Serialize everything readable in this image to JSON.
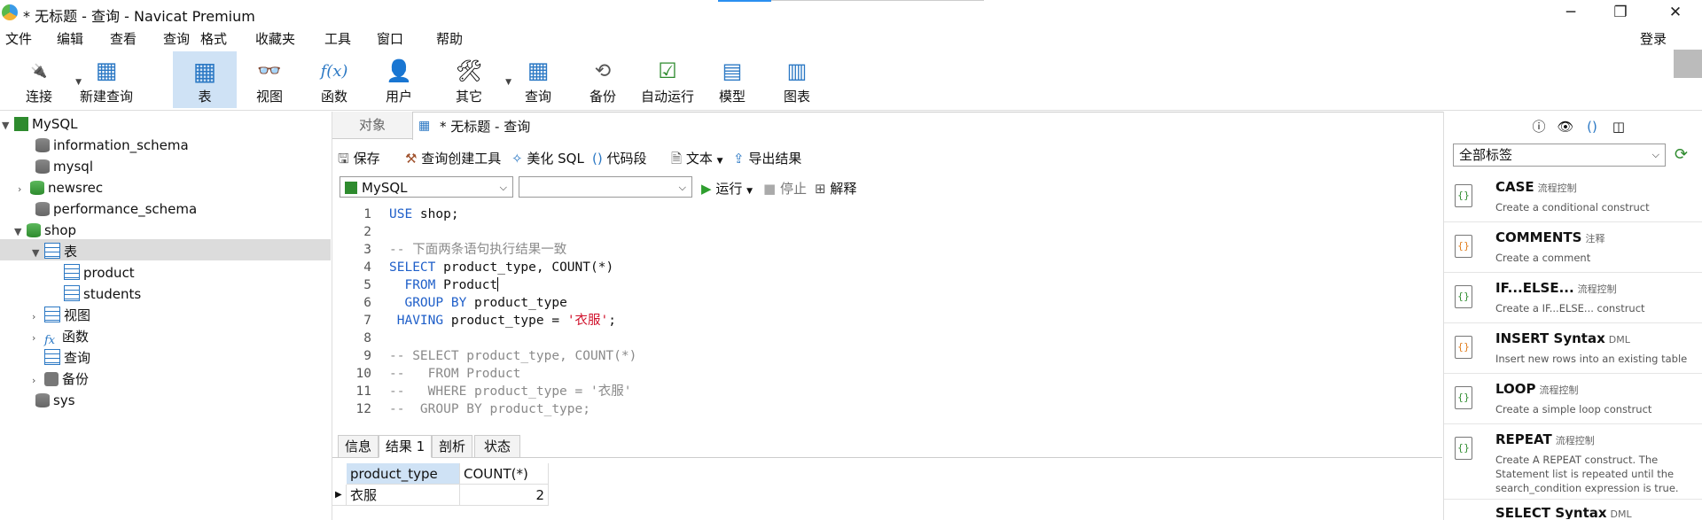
{
  "window": {
    "title": "* 无标题 - 查询 - Navicat Premium",
    "minimize": "─",
    "maximize": "❐",
    "close": "✕"
  },
  "menu": [
    "文件",
    "编辑",
    "查看",
    "查询",
    "格式",
    "收藏夹",
    "工具",
    "窗口",
    "帮助"
  ],
  "login": "登录",
  "toolbar": [
    {
      "label": "连接",
      "icon": "plug-icon",
      "glyph": "🔌"
    },
    {
      "label": "新建查询",
      "icon": "new-query-icon",
      "glyph": "▦"
    },
    {
      "label": "表",
      "icon": "table-icon",
      "glyph": "▦"
    },
    {
      "label": "视图",
      "icon": "view-icon",
      "glyph": "👓"
    },
    {
      "label": "函数",
      "icon": "function-icon",
      "glyph": "f(x)"
    },
    {
      "label": "用户",
      "icon": "user-icon",
      "glyph": "👤"
    },
    {
      "label": "其它",
      "icon": "tools-icon",
      "glyph": "🛠"
    },
    {
      "label": "查询",
      "icon": "query-icon",
      "glyph": "▦"
    },
    {
      "label": "备份",
      "icon": "backup-icon",
      "glyph": "⟲"
    },
    {
      "label": "自动运行",
      "icon": "schedule-icon",
      "glyph": "☑"
    },
    {
      "label": "模型",
      "icon": "model-icon",
      "glyph": "▤"
    },
    {
      "label": "图表",
      "icon": "chart-icon",
      "glyph": "▥"
    }
  ],
  "tree": {
    "connection": "MySQL",
    "databases": [
      "information_schema",
      "mysql",
      "newsrec",
      "performance_schema",
      "shop"
    ],
    "shop_children": {
      "tables": "表",
      "views": "视图",
      "functions": "函数",
      "queries": "查询",
      "backups": "备份"
    },
    "tables": [
      "product",
      "students"
    ],
    "last": "sys"
  },
  "tabs": {
    "objects": "对象",
    "query": "* 无标题 - 查询"
  },
  "query_toolbar": {
    "save": "保存",
    "builder": "查询创建工具",
    "beautify": "美化 SQL",
    "snippet": "代码段",
    "text": "文本",
    "export": "导出结果"
  },
  "db_bar": {
    "connection": "MySQL",
    "database": "",
    "run": "运行",
    "stop": "停止",
    "explain": "解释"
  },
  "editor_lines": [
    "USE shop;",
    "",
    "-- 下面两条语句执行结果一致",
    "SELECT product_type, COUNT(*)",
    "  FROM Product",
    "  GROUP BY product_type",
    " HAVING product_type = '衣服';",
    "",
    "-- SELECT product_type, COUNT(*)",
    "--   FROM Product",
    "--   WHERE product_type = '衣服'",
    "--  GROUP BY product_type;"
  ],
  "result_tabs": [
    "信息",
    "结果 1",
    "剖析",
    "状态"
  ],
  "result": {
    "columns": [
      "product_type",
      "COUNT(*)"
    ],
    "rows": [
      [
        "衣服",
        "2"
      ]
    ]
  },
  "right_panel": {
    "tag_select": "全部标签",
    "snippets": [
      {
        "name": "CASE",
        "cat": "流程控制",
        "desc": "Create a conditional construct"
      },
      {
        "name": "COMMENTS",
        "cat": "注释",
        "desc": "Create a comment"
      },
      {
        "name": "IF...ELSE...",
        "cat": "流程控制",
        "desc": "Create a IF...ELSE... construct"
      },
      {
        "name": "INSERT Syntax",
        "cat": "DML",
        "desc": "Insert new rows into an existing table"
      },
      {
        "name": "LOOP",
        "cat": "流程控制",
        "desc": "Create a simple loop construct"
      },
      {
        "name": "REPEAT",
        "cat": "流程控制",
        "desc": "Create A REPEAT construct. The Statement list is repeated until the search_condition expression is true."
      },
      {
        "name": "SELECT Syntax",
        "cat": "DML",
        "desc": ""
      }
    ]
  }
}
